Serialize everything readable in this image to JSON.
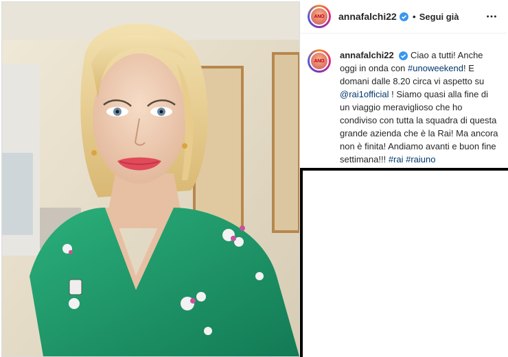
{
  "header": {
    "username": "annafalchi22",
    "separator": "•",
    "follow_label": "Segui già",
    "avatar_logo": "ANO",
    "verified_icon": "verified-badge-icon",
    "more_icon": "more-options-icon"
  },
  "caption": {
    "username": "annafalchi22",
    "parts": [
      "Ciao a tutti! Anche oggi in onda con ",
      "#unoweekend",
      "! E domani dalle 8.20 circa vi aspetto su ",
      "@rai1official",
      " ! Siamo quasi alla fine di un viaggio meraviglioso che ho condiviso con tutta la squadra di questa grande azienda che è la Rai! Ma ancora non è finita! Andiamo avanti e buon fine settimana!!! ",
      "#rai",
      " ",
      "#raiuno"
    ]
  },
  "colors": {
    "link": "#00376b",
    "verified": "#3897f0",
    "dress": "#1f9a6a",
    "hair": "#e6c98a"
  }
}
